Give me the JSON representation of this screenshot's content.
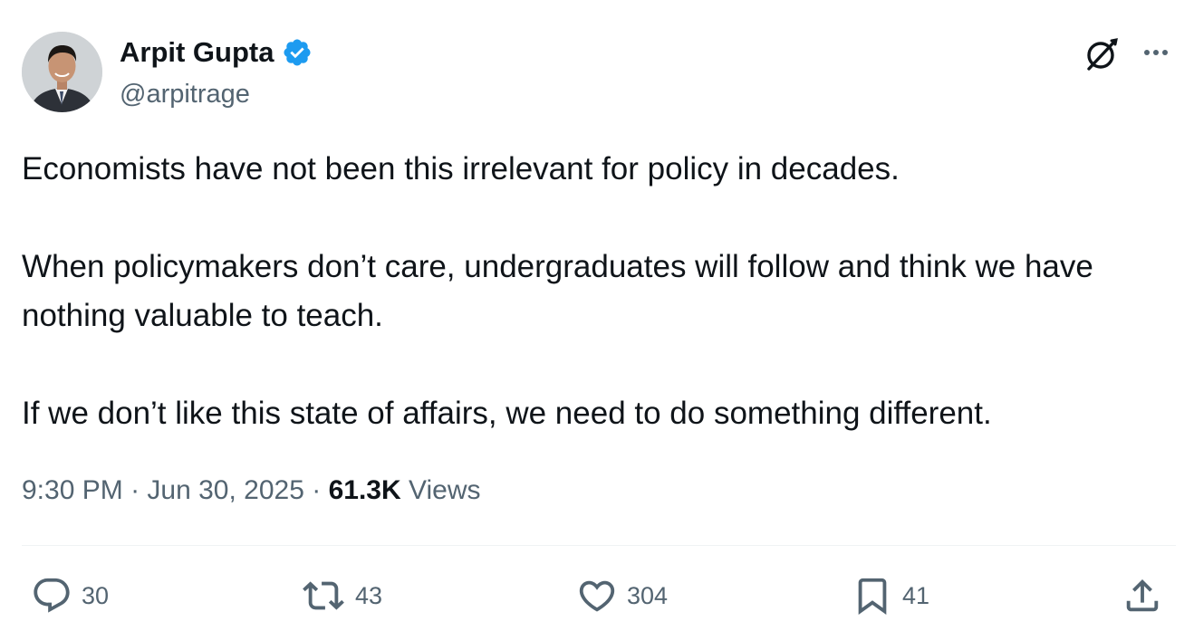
{
  "author": {
    "name": "Arpit Gupta",
    "handle": "@arpitrage",
    "verified": true,
    "verified_color": "#1d9bf0"
  },
  "tweet": {
    "paragraphs": [
      "Economists have not been this irrelevant for policy in decades.",
      "When policymakers don’t care, undergraduates will follow and think we have nothing valuable to teach.",
      "If we don’t like this state of affairs, we need to do something different."
    ],
    "time": "9:30 PM",
    "separator": "·",
    "date": "Jun 30, 2025",
    "views_count": "61.3K",
    "views_label": "Views"
  },
  "actions": {
    "reply_count": "30",
    "retweet_count": "43",
    "like_count": "304",
    "bookmark_count": "41"
  },
  "icons": {
    "header": [
      "grok-icon",
      "more-icon"
    ],
    "actions": [
      "reply-icon",
      "retweet-icon",
      "like-icon",
      "bookmark-icon",
      "share-icon"
    ]
  },
  "colors": {
    "text_primary": "#0f1419",
    "text_secondary": "#536471",
    "divider": "#eff3f4"
  }
}
